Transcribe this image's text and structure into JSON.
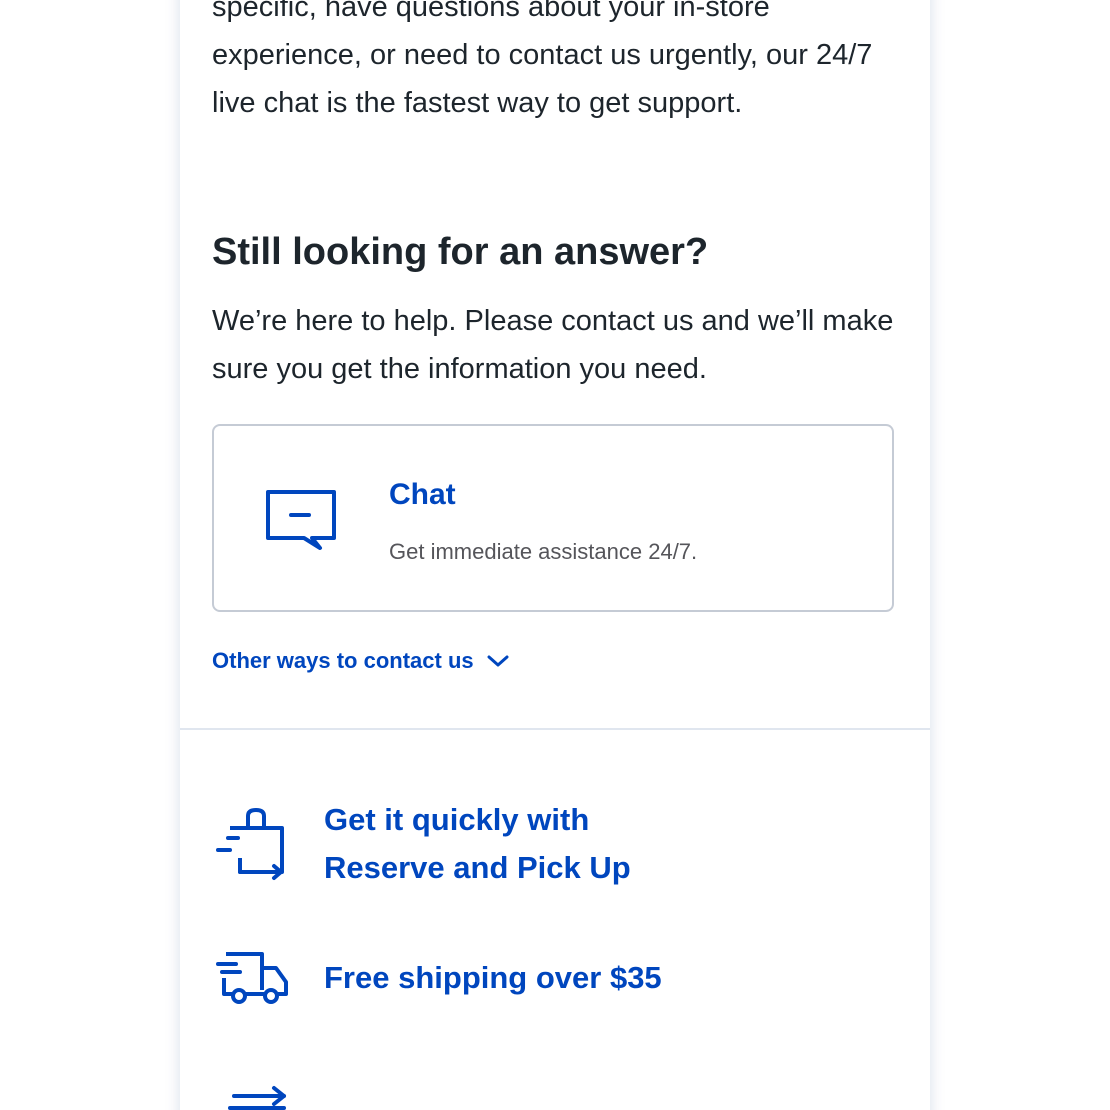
{
  "intro": {
    "text": "specific, have questions about your in-store experience, or need to contact us urgently, our 24/7 live chat is the fastest way to get support."
  },
  "help_section": {
    "heading": "Still looking for an answer?",
    "text": "We’re here to help. Please contact us and we’ll make sure you get the information you need."
  },
  "chat_card": {
    "icon": "chat-bubble-icon",
    "title": "Chat",
    "subtitle": "Get immediate assistance 24/7."
  },
  "other_ways": {
    "label": "Other ways to contact us",
    "icon": "chevron-down-icon"
  },
  "features": [
    {
      "icon": "shopping-bag-pickup-icon",
      "label": "Get it quickly with Reserve and Pick Up"
    },
    {
      "icon": "delivery-truck-icon",
      "label": "Free shipping over $35"
    },
    {
      "icon": "fast-arrows-icon",
      "label": ""
    }
  ],
  "colors": {
    "accent": "#0046be",
    "text": "#1d252c",
    "muted": "#55555a",
    "border": "#c5cbd5"
  }
}
